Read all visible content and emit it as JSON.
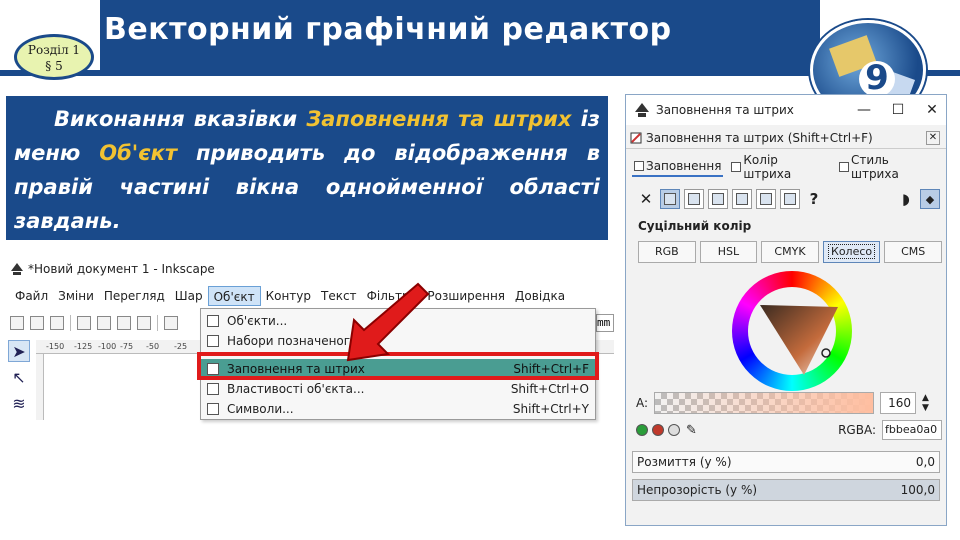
{
  "header": {
    "title": "Векторний графічний редактор",
    "chapter_line1": "Розділ 1",
    "chapter_line2": "§ 5",
    "grade": "9"
  },
  "description": {
    "p1": "Виконання вказівки ",
    "h1": "Заповнення та штрих",
    "p2": " із меню ",
    "h2": "Об'єкт",
    "p3": " приводить до відображення в правій частині вікна однойменної області завдань."
  },
  "inkscape": {
    "window_title": "*Новий документ 1 - Inkscape",
    "menu": [
      "Файл",
      "Зміни",
      "Перегляд",
      "Шар",
      "Об'єкт",
      "Контур",
      "Текст",
      "Фільтри",
      "Розширення",
      "Довідка"
    ],
    "ruler_labels": [
      "-150",
      "-125",
      "-100",
      "-75",
      "-50",
      "-25"
    ],
    "combo_stub": "mm",
    "dropdown": [
      {
        "label": "Об'єкти...",
        "shortcut": ""
      },
      {
        "label": "Набори позначеного...",
        "shortcut": ""
      },
      {
        "label": "Заповнення та штрих",
        "shortcut": "Shift+Ctrl+F"
      },
      {
        "label": "Властивості об'єкта...",
        "shortcut": "Shift+Ctrl+O"
      },
      {
        "label": "Символи...",
        "shortcut": "Shift+Ctrl+Y"
      }
    ]
  },
  "fill_stroke": {
    "window_title": "Заповнення та штрих",
    "dock_title": "Заповнення та штрих (Shift+Ctrl+F)",
    "tabs": [
      "Заповнення",
      "Колір штриха",
      "Стиль штриха"
    ],
    "flat_color_label": "Суцільний колір",
    "modes": [
      "RGB",
      "HSL",
      "CMYK",
      "Колесо",
      "CMS"
    ],
    "active_mode": "Колесо",
    "alpha_label": "A:",
    "alpha_value": "160",
    "rgba_label": "RGBA:",
    "rgba_value": "fbbea0a0",
    "blur_label": "Розмиття (у %)",
    "blur_value": "0,0",
    "opacity_label": "Непрозорість (у %)",
    "opacity_value": "100,0",
    "unset_glyph": "?",
    "x_glyph": "✕"
  },
  "colors": {
    "brand_blue": "#1a4a8a",
    "highlight": "#f1c232",
    "selected_item": "#4a9d92",
    "red": "#e01b1b"
  }
}
